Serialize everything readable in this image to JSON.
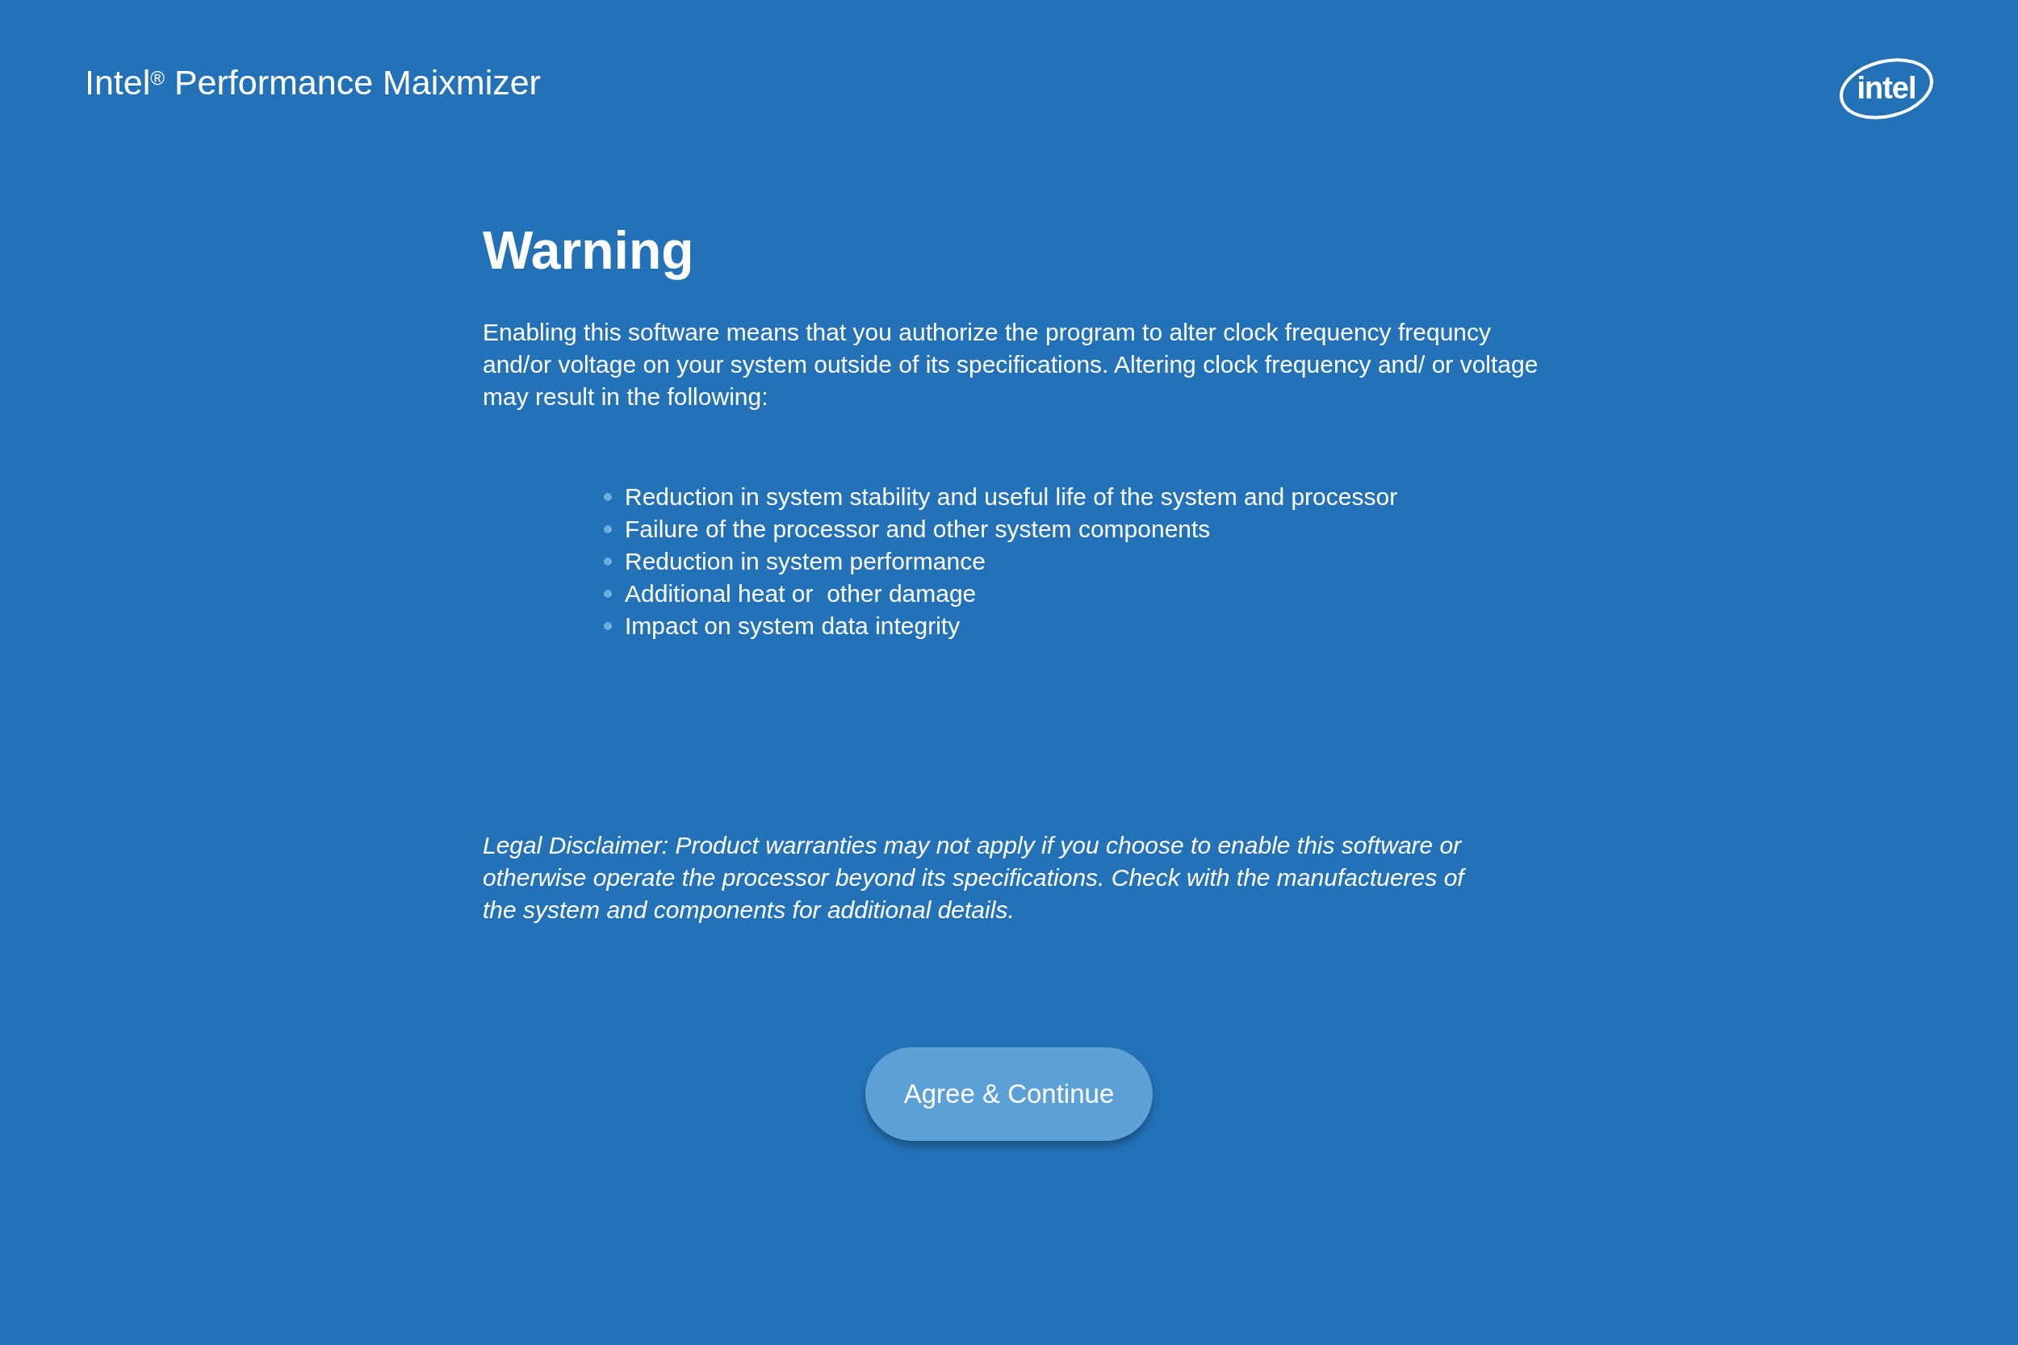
{
  "app_title": "Intel$^{®}$ Performance Maixmizer",
  "logo": {
    "text": "intel"
  },
  "heading": "Warning",
  "intro": "Enabling this software means that you authorize the program to alter clock frequency frequncy and/or voltage on your system outside of its specifications. Altering clock frequency and/ or voltage may result in the following:",
  "consequences": [
    "Reduction in system stability and useful life of the system and processor",
    "Failure of the processor and other system components",
    "Reduction in system performance",
    "Additional heat or  other damage",
    "Impact on system data integrity"
  ],
  "disclaimer": "Legal Disclaimer: Product warranties may not apply if you choose to enable this software or otherwise operate the processor beyond its specifications. Check with the manufactueres of the system and components for additional details.",
  "button": "Agree & Continue"
}
